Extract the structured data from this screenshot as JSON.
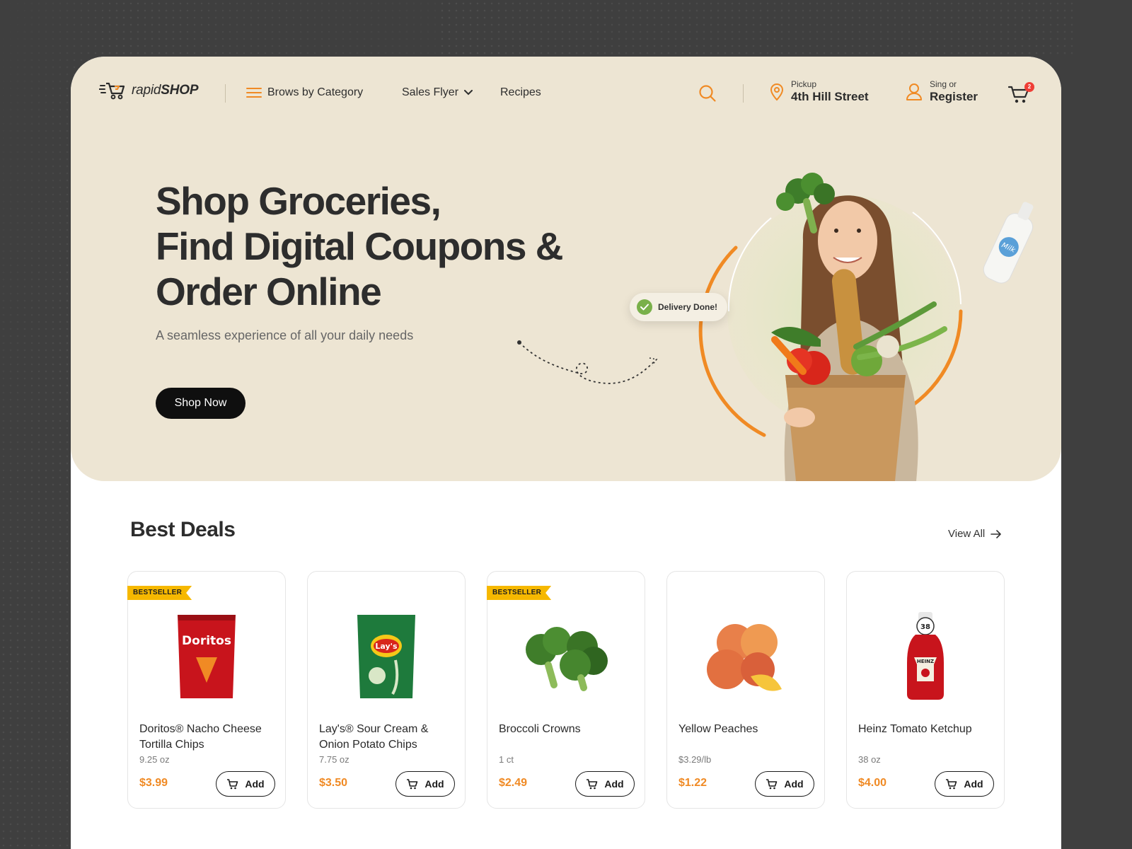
{
  "colors": {
    "accent": "#f08a24",
    "hero_bg": "#ede5d3",
    "dark": "#0f0f0f",
    "badge": "#f6b800",
    "check": "#79b04a"
  },
  "brand": {
    "prefix": "rapid",
    "suffix": "SHOP"
  },
  "nav": {
    "category_label": "Brows by Category",
    "sales_flyer_label": "Sales Flyer",
    "recipes_label": "Recipes",
    "pickup_label": "Pickup",
    "pickup_location": "4th Hill Street",
    "account_small": "Sing or",
    "account_big": "Register",
    "cart_count": "2"
  },
  "hero": {
    "title_line1": "Shop Groceries,",
    "title_line2": "Find Digital Coupons &",
    "title_line3": "Order Online",
    "subtitle": "A seamless experience of all your daily needs",
    "cta": "Shop Now",
    "delivery_status": "Delivery Done!",
    "milk_label": "Milk"
  },
  "deals": {
    "title": "Best Deals",
    "view_all": "View All",
    "badge_label": "BESTSELLER",
    "add_label": "Add",
    "products": [
      {
        "name": "Doritos® Nacho Cheese Tortilla Chips",
        "size": "9.25 oz",
        "price": "$3.99",
        "bestseller": true,
        "icon": "chips-bag-red",
        "brand_text": "Doritos"
      },
      {
        "name": "Lay's® Sour Cream & Onion Potato Chips",
        "size": "7.75 oz",
        "price": "$3.50",
        "bestseller": false,
        "icon": "chips-bag-green",
        "brand_text": "Lay's"
      },
      {
        "name": "Broccoli Crowns",
        "size": "1 ct",
        "price": "$2.49",
        "bestseller": true,
        "icon": "broccoli"
      },
      {
        "name": "Yellow Peaches",
        "size": "$3.29/lb",
        "price": "$1.22",
        "bestseller": false,
        "icon": "peaches"
      },
      {
        "name": "Heinz Tomato Ketchup",
        "size": "38 oz",
        "price": "$4.00",
        "bestseller": false,
        "icon": "ketchup-bottle",
        "brand_text": "HEINZ",
        "bottle_size": "38"
      }
    ]
  }
}
